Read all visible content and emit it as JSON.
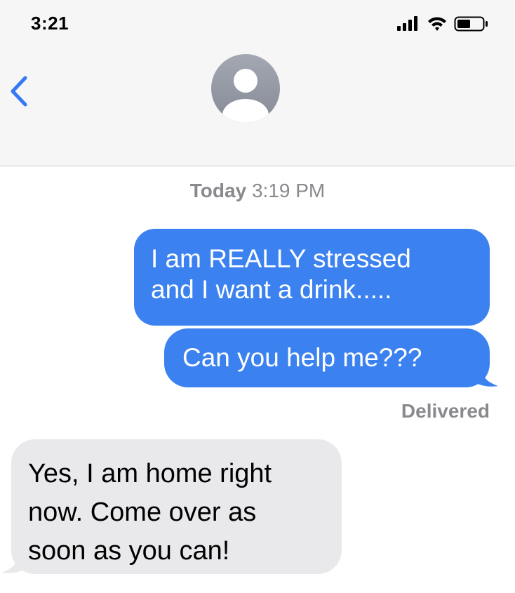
{
  "status_bar": {
    "time": "3:21",
    "icons": [
      "signal-icon",
      "wifi-icon",
      "battery-icon"
    ]
  },
  "header": {
    "back_icon": "chevron-left-icon",
    "avatar_icon": "person-avatar-icon",
    "accent_color": "#3478f6"
  },
  "conversation": {
    "timestamp_day": "Today",
    "timestamp_time": "3:19 PM",
    "messages": [
      {
        "direction": "outgoing",
        "lines": [
          "I am REALLY stressed",
          "and I want a drink....."
        ]
      },
      {
        "direction": "outgoing",
        "lines": [
          "Can you help me???"
        ]
      },
      {
        "direction": "incoming",
        "lines": [
          "Yes, I am home right",
          "now.  Come over as",
          "soon as you can!"
        ]
      }
    ],
    "delivery_status": "Delivered"
  },
  "colors": {
    "outgoing_bubble": "#3b82f0",
    "incoming_bubble": "#e9e9eb",
    "header_background": "#f6f6f6",
    "secondary_text": "#8a8a8e"
  }
}
